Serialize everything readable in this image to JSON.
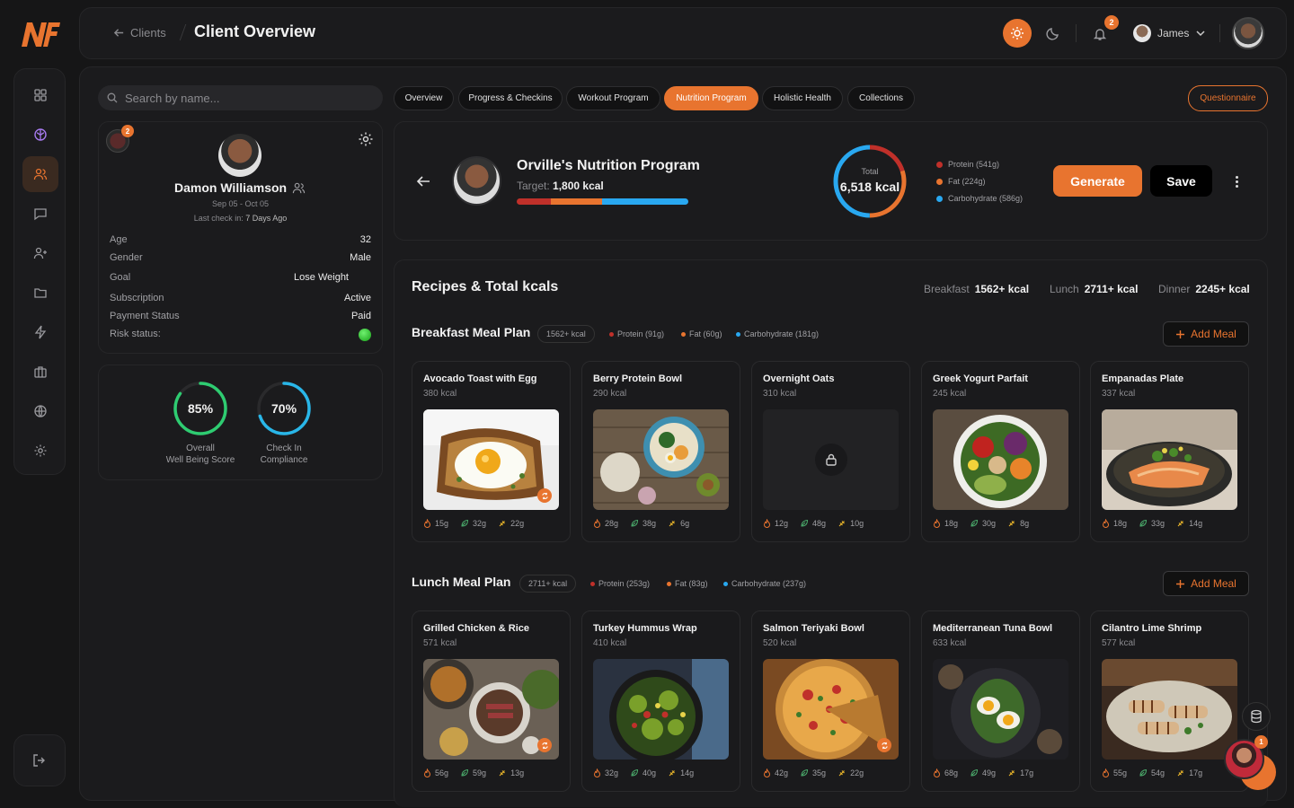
{
  "header": {
    "back_label": "Clients",
    "page_title": "Client Overview",
    "notification_count": "2",
    "user_name": "James"
  },
  "search": {
    "placeholder": "Search by name..."
  },
  "profile": {
    "badge_count": "2",
    "name": "Damon Williamson",
    "dates": "Sep 05 - Oct 05",
    "last_checkin_label": "Last check in:",
    "last_checkin_value": "7 Days Ago",
    "stats": [
      {
        "label": "Age",
        "value": "32"
      },
      {
        "label": "Gender",
        "value": "Male"
      },
      {
        "label": "Goal",
        "value": "Lose Weight"
      },
      {
        "label": "Subscription",
        "value": "Active"
      },
      {
        "label": "Payment Status",
        "value": "Paid"
      },
      {
        "label": "Risk status:",
        "value": ""
      }
    ],
    "risk_color": "#22c022"
  },
  "scores": [
    {
      "value": "85%",
      "fraction": 0.85,
      "label": "Overall\nWell Being Score",
      "color": "#2ecc71"
    },
    {
      "value": "70%",
      "fraction": 0.7,
      "label": "Check In\nCompliance",
      "color": "#29b6e8"
    }
  ],
  "tabs": [
    "Overview",
    "Progress & Checkins",
    "Workout Program",
    "Nutrition Program",
    "Holistic Health",
    "Collections"
  ],
  "active_tab": "Nutrition Program",
  "questionnaire_label": "Questionnaire",
  "program": {
    "title": "Orville's Nutrition Program",
    "target_label": "Target:",
    "target_value": "1,800 kcal",
    "total_label": "Total",
    "total_value": "6,518 kcal",
    "macros": [
      {
        "label": "Protein (541g)",
        "color": "#c0302a",
        "share": 0.2
      },
      {
        "label": "Fat (224g)",
        "color": "#e8742f",
        "share": 0.3
      },
      {
        "label": "Carbohydrate (586g)",
        "color": "#29a8f0",
        "share": 0.5
      }
    ],
    "generate_label": "Generate",
    "save_label": "Save"
  },
  "recipes": {
    "title": "Recipes & Total kcals",
    "totals": [
      {
        "label": "Breakfast",
        "value": "1562+ kcal"
      },
      {
        "label": "Lunch",
        "value": "2711+ kcal"
      },
      {
        "label": "Dinner",
        "value": "2245+ kcal"
      }
    ],
    "add_meal_label": "Add Meal",
    "plans": [
      {
        "title": "Breakfast Meal Plan",
        "kcal": "1562+ kcal",
        "macros": [
          "Protein (91g)",
          "Fat (60g)",
          "Carbohydrate (181g)"
        ],
        "meals": [
          {
            "name": "Avocado Toast with Egg",
            "kcal": "380 kcal",
            "p": "15g",
            "c": "32g",
            "f": "22g",
            "img": "toast"
          },
          {
            "name": "Berry Protein Bowl",
            "kcal": "290 kcal",
            "p": "28g",
            "c": "38g",
            "f": "6g",
            "img": "bowl"
          },
          {
            "name": "Overnight Oats",
            "kcal": "310 kcal",
            "p": "12g",
            "c": "48g",
            "f": "10g",
            "img": "locked"
          },
          {
            "name": "Greek Yogurt Parfait",
            "kcal": "245 kcal",
            "p": "18g",
            "c": "30g",
            "f": "8g",
            "img": "salad"
          },
          {
            "name": "Empanadas Plate",
            "kcal": "337 kcal",
            "p": "18g",
            "c": "33g",
            "f": "14g",
            "img": "salmon"
          }
        ]
      },
      {
        "title": "Lunch Meal Plan",
        "kcal": "2711+ kcal",
        "macros": [
          "Protein (253g)",
          "Fat (83g)",
          "Carbohydrate (237g)"
        ],
        "meals": [
          {
            "name": "Grilled Chicken & Rice",
            "kcal": "571 kcal",
            "p": "56g",
            "c": "59g",
            "f": "13g",
            "img": "plates"
          },
          {
            "name": "Turkey Hummus Wrap",
            "kcal": "410 kcal",
            "p": "32g",
            "c": "40g",
            "f": "14g",
            "img": "greens"
          },
          {
            "name": "Salmon Teriyaki Bowl",
            "kcal": "520 kcal",
            "p": "42g",
            "c": "35g",
            "f": "22g",
            "img": "pizza"
          },
          {
            "name": "Mediterranean Tuna Bowl",
            "kcal": "633 kcal",
            "p": "68g",
            "c": "49g",
            "f": "17g",
            "img": "eggs"
          },
          {
            "name": "Cilantro Lime Shrimp",
            "kcal": "577 kcal",
            "p": "55g",
            "c": "54g",
            "f": "17g",
            "img": "grill"
          }
        ]
      }
    ]
  },
  "chat_badge": "1"
}
